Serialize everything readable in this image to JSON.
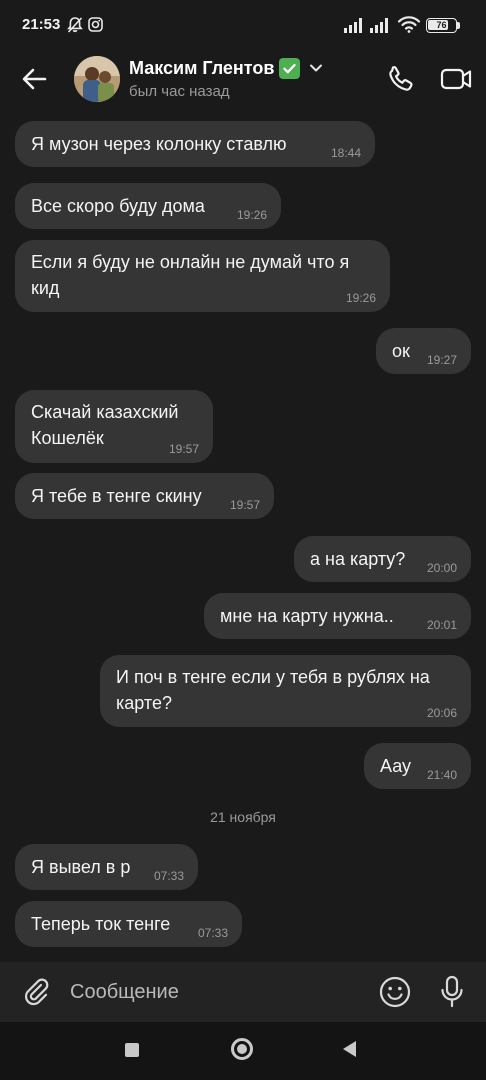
{
  "status_bar": {
    "time": "21:53",
    "battery": "76",
    "battery_fraction": 0.76
  },
  "header": {
    "contact_name": "Максим Глентов",
    "verified_emoji": "✅",
    "last_seen": "был час назад"
  },
  "messages": [
    {
      "text": "Я музон через колонку ставлю",
      "time": "18:44",
      "direction": "in"
    },
    {
      "text": "Все скоро буду дома",
      "time": "19:26",
      "direction": "in"
    },
    {
      "text": "Если я буду не онлайн не думай что я\nкид",
      "time": "19:26",
      "direction": "in"
    },
    {
      "text": "ок",
      "time": "19:27",
      "direction": "out"
    },
    {
      "text": "Скачай казахский\nКошелёк",
      "time": "19:57",
      "direction": "in"
    },
    {
      "text": "Я тебе в тенге скину",
      "time": "19:57",
      "direction": "in"
    },
    {
      "text": "а на карту?",
      "time": "20:00",
      "direction": "out"
    },
    {
      "text": "мне на карту нужна..",
      "time": "20:01",
      "direction": "out"
    },
    {
      "text": "И поч в тенге если у тебя в рублях на\nкарте?",
      "time": "20:06",
      "direction": "out"
    },
    {
      "text": "Аау",
      "time": "21:40",
      "direction": "out"
    },
    {
      "text": "Я вывел в р",
      "time": "07:33",
      "direction": "in"
    },
    {
      "text": "Теперь ток тенге",
      "time": "07:33",
      "direction": "in"
    }
  ],
  "date_separator": "21 ноября",
  "composer": {
    "placeholder": "Сообщение"
  },
  "colors": {
    "background": "#1a1a1a",
    "bubble": "#353535",
    "verified": "#4caf50"
  },
  "icons": {
    "back": "arrow-left-icon",
    "call": "phone-icon",
    "video": "video-camera-icon",
    "attach": "paperclip-icon",
    "emoji": "smiley-icon",
    "mic": "microphone-icon"
  }
}
